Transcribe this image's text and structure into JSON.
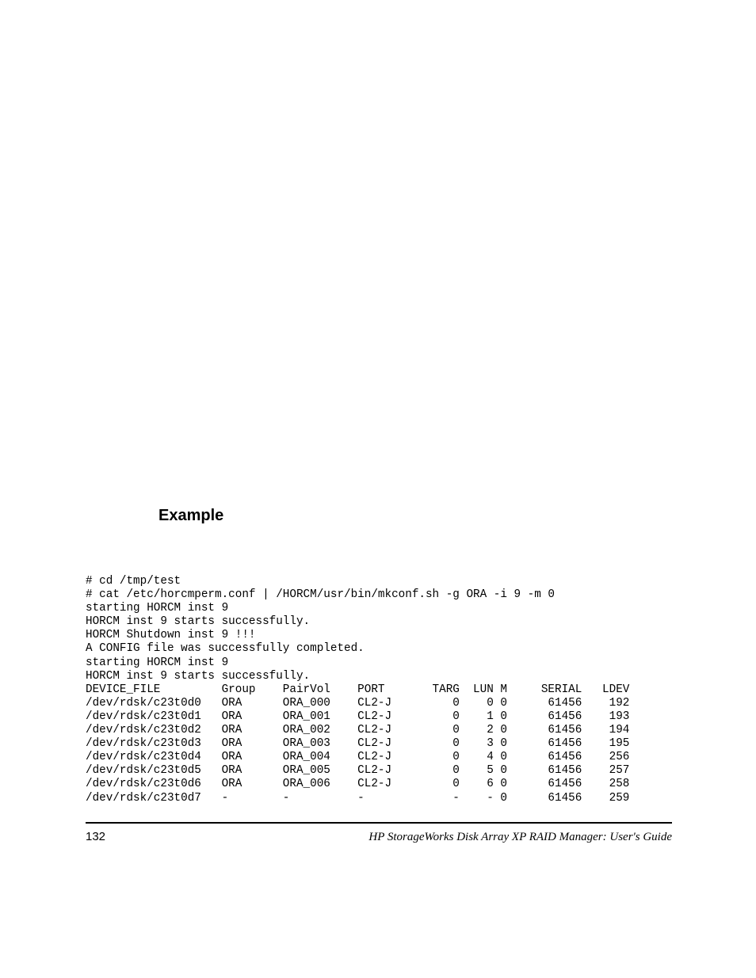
{
  "heading": "Example",
  "code": {
    "pre_lines": [
      "# cd /tmp/test",
      "# cat /etc/horcmperm.conf | /HORCM/usr/bin/mkconf.sh -g ORA -i 9 -m 0",
      "starting HORCM inst 9",
      "HORCM inst 9 starts successfully.",
      "HORCM Shutdown inst 9 !!!",
      "A CONFIG file was successfully completed.",
      "starting HORCM inst 9",
      "HORCM inst 9 starts successfully."
    ],
    "header": {
      "device_file": "DEVICE_FILE",
      "group": "Group",
      "pairvol": "PairVol",
      "port": "PORT",
      "targ": "TARG",
      "lun": "LUN",
      "m": "M",
      "serial": "SERIAL",
      "ldev": "LDEV"
    },
    "rows": [
      {
        "device_file": "/dev/rdsk/c23t0d0",
        "group": "ORA",
        "pairvol": "ORA_000",
        "port": "CL2-J",
        "targ": "0",
        "lun": "0",
        "m": "0",
        "serial": "61456",
        "ldev": "192"
      },
      {
        "device_file": "/dev/rdsk/c23t0d1",
        "group": "ORA",
        "pairvol": "ORA_001",
        "port": "CL2-J",
        "targ": "0",
        "lun": "1",
        "m": "0",
        "serial": "61456",
        "ldev": "193"
      },
      {
        "device_file": "/dev/rdsk/c23t0d2",
        "group": "ORA",
        "pairvol": "ORA_002",
        "port": "CL2-J",
        "targ": "0",
        "lun": "2",
        "m": "0",
        "serial": "61456",
        "ldev": "194"
      },
      {
        "device_file": "/dev/rdsk/c23t0d3",
        "group": "ORA",
        "pairvol": "ORA_003",
        "port": "CL2-J",
        "targ": "0",
        "lun": "3",
        "m": "0",
        "serial": "61456",
        "ldev": "195"
      },
      {
        "device_file": "/dev/rdsk/c23t0d4",
        "group": "ORA",
        "pairvol": "ORA_004",
        "port": "CL2-J",
        "targ": "0",
        "lun": "4",
        "m": "0",
        "serial": "61456",
        "ldev": "256"
      },
      {
        "device_file": "/dev/rdsk/c23t0d5",
        "group": "ORA",
        "pairvol": "ORA_005",
        "port": "CL2-J",
        "targ": "0",
        "lun": "5",
        "m": "0",
        "serial": "61456",
        "ldev": "257"
      },
      {
        "device_file": "/dev/rdsk/c23t0d6",
        "group": "ORA",
        "pairvol": "ORA_006",
        "port": "CL2-J",
        "targ": "0",
        "lun": "6",
        "m": "0",
        "serial": "61456",
        "ldev": "258"
      },
      {
        "device_file": "/dev/rdsk/c23t0d7",
        "group": "-",
        "pairvol": "-",
        "port": "-",
        "targ": "-",
        "lun": "-",
        "m": "0",
        "serial": "61456",
        "ldev": "259"
      }
    ]
  },
  "footer": {
    "page_number": "132",
    "title": "HP StorageWorks Disk Array XP RAID Manager: User's Guide"
  }
}
